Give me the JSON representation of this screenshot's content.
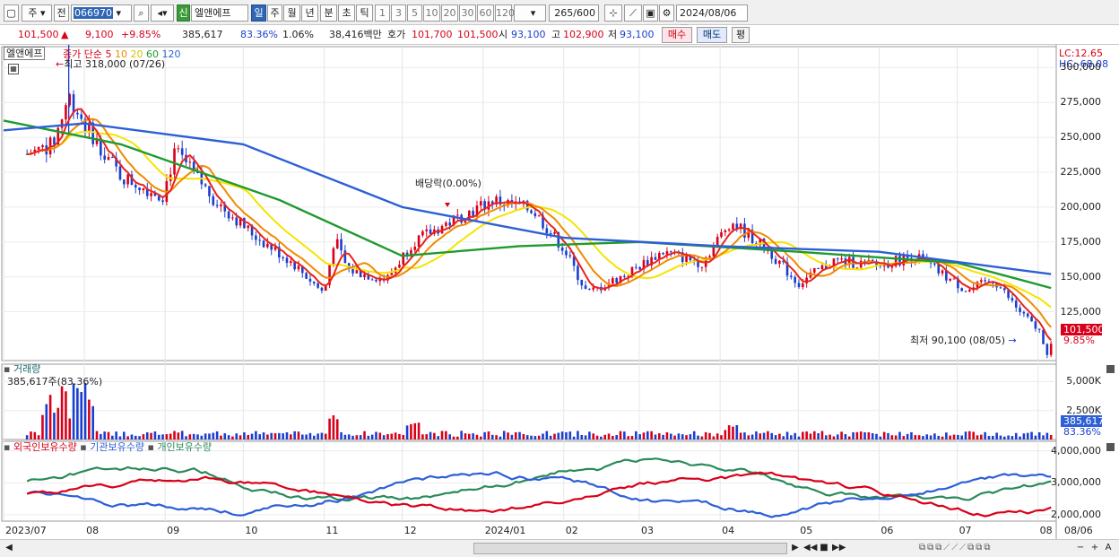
{
  "toolbar": {
    "market": "주",
    "prefix": "전",
    "code": "066970",
    "name": "엘앤에프",
    "badge": "신",
    "periods": [
      "일",
      "주",
      "월",
      "년",
      "분",
      "초",
      "틱"
    ],
    "active_period": "일",
    "intervals": [
      "1",
      "3",
      "5",
      "10",
      "20",
      "30",
      "60",
      "120"
    ],
    "count": "265",
    "count_total": "/600",
    "date": "2024/08/06"
  },
  "quote": {
    "price": "101,500",
    "change": "9,100",
    "change_pct": "+9.85%",
    "volume": "385,617",
    "volume_ratio": "83.36%",
    "turnover_rate": "1.06%",
    "amount": "38,416백만",
    "ask_label": "호가",
    "ask1": "101,700",
    "ask2": "101,500",
    "open_label": "시",
    "open": "93,100",
    "high_label": "고",
    "high": "102,900",
    "low_label": "저",
    "low": "93,100",
    "buy": "매수",
    "sell": "매도",
    "avg": "평"
  },
  "chart_legend": {
    "name": "엘앤에프",
    "ma_label": "종가 단순 5",
    "ma10": "10",
    "ma20": "20",
    "ma60": "60",
    "ma120": "120",
    "high_marker": "최고 318,000 (07/26)",
    "low_marker": "최저 90,100 (08/05)",
    "dividend": "배당락(0.00%)",
    "lc": "LC:12.65",
    "hc": "HC:-68.08",
    "current_price": "101,500",
    "current_pct": "9.85%",
    "volume_title": "거래량",
    "volume_value": "385,617주(83.36%)",
    "volume_current": "385,617",
    "volume_pct": "83.36%",
    "holdings_foreign": "외국인보유수량",
    "holdings_inst": "기관보유수량",
    "holdings_indiv": "개인보유수량"
  },
  "colors": {
    "up": "#d8001a",
    "down": "#1a3fd0",
    "ma5": "#e8241c",
    "ma10": "#f08a00",
    "ma20": "#f5e400",
    "ma60": "#1f9a2e",
    "ma120": "#2d5fd6",
    "foreign": "#2d5fd6",
    "institution": "#d8001a",
    "individual": "#2a8a5a"
  },
  "chart_data": [
    {
      "type": "candlestick",
      "title": "",
      "y_ticks": [
        "300,000",
        "275,000",
        "250,000",
        "225,000",
        "200,000",
        "175,000",
        "150,000",
        "125,000"
      ],
      "ylim": [
        90000,
        315000
      ],
      "x_labels": [
        "2023/07",
        "08",
        "09",
        "10",
        "11",
        "12",
        "2024/01",
        "02",
        "03",
        "04",
        "05",
        "06",
        "07",
        "08",
        "08/06"
      ],
      "close_path": [
        [
          "2023/07/10",
          238000
        ],
        [
          "2023/07/20",
          245000
        ],
        [
          "2023/07/26",
          280000
        ],
        [
          "2023/08/01",
          260000
        ],
        [
          "2023/08/15",
          222000
        ],
        [
          "2023/08/31",
          208000
        ],
        [
          "2023/09/05",
          240000
        ],
        [
          "2023/09/20",
          205000
        ],
        [
          "2023/10/05",
          180000
        ],
        [
          "2023/10/20",
          160000
        ],
        [
          "2023/11/01",
          138000
        ],
        [
          "2023/11/05",
          178000
        ],
        [
          "2023/11/10",
          155000
        ],
        [
          "2023/11/25",
          148000
        ],
        [
          "2023/12/05",
          175000
        ],
        [
          "2023/12/20",
          190000
        ],
        [
          "2024/01/05",
          205000
        ],
        [
          "2024/01/20",
          198000
        ],
        [
          "2024/02/01",
          170000
        ],
        [
          "2024/02/10",
          138000
        ],
        [
          "2024/02/25",
          152000
        ],
        [
          "2024/03/10",
          168000
        ],
        [
          "2024/03/25",
          160000
        ],
        [
          "2024/04/05",
          190000
        ],
        [
          "2024/04/20",
          168000
        ],
        [
          "2024/05/01",
          145000
        ],
        [
          "2024/05/15",
          162000
        ],
        [
          "2024/05/31",
          158000
        ],
        [
          "2024/06/15",
          165000
        ],
        [
          "2024/06/25",
          152000
        ],
        [
          "2024/07/05",
          140000
        ],
        [
          "2024/07/15",
          148000
        ],
        [
          "2024/07/25",
          125000
        ],
        [
          "2024/08/02",
          110000
        ],
        [
          "2024/08/05",
          93100
        ],
        [
          "2024/08/06",
          101500
        ]
      ],
      "ma120_path": [
        [
          "2023/07/01",
          255000
        ],
        [
          "2023/08/01",
          260000
        ],
        [
          "2023/10/01",
          245000
        ],
        [
          "2023/12/01",
          200000
        ],
        [
          "2024/02/01",
          178000
        ],
        [
          "2024/04/01",
          172000
        ],
        [
          "2024/06/01",
          168000
        ],
        [
          "2024/08/06",
          152000
        ]
      ],
      "ma60_path": [
        [
          "2023/07/01",
          262000
        ],
        [
          "2023/08/15",
          245000
        ],
        [
          "2023/10/15",
          205000
        ],
        [
          "2023/12/01",
          165000
        ],
        [
          "2024/01/15",
          172000
        ],
        [
          "2024/03/01",
          175000
        ],
        [
          "2024/05/01",
          168000
        ],
        [
          "2024/07/01",
          160000
        ],
        [
          "2024/08/06",
          142000
        ]
      ]
    },
    {
      "type": "bar",
      "title": "거래량",
      "y_ticks": [
        "5,000K",
        "2,500K"
      ],
      "ylim": [
        0,
        6500000
      ]
    },
    {
      "type": "line",
      "series": [
        {
          "name": "외국인보유수량"
        },
        {
          "name": "기관보유수량"
        },
        {
          "name": "개인보유수량"
        }
      ],
      "y_ticks": [
        "4,000,000",
        "3,000,000",
        "2,000,000"
      ],
      "ylim": [
        1800000,
        4300000
      ]
    }
  ]
}
